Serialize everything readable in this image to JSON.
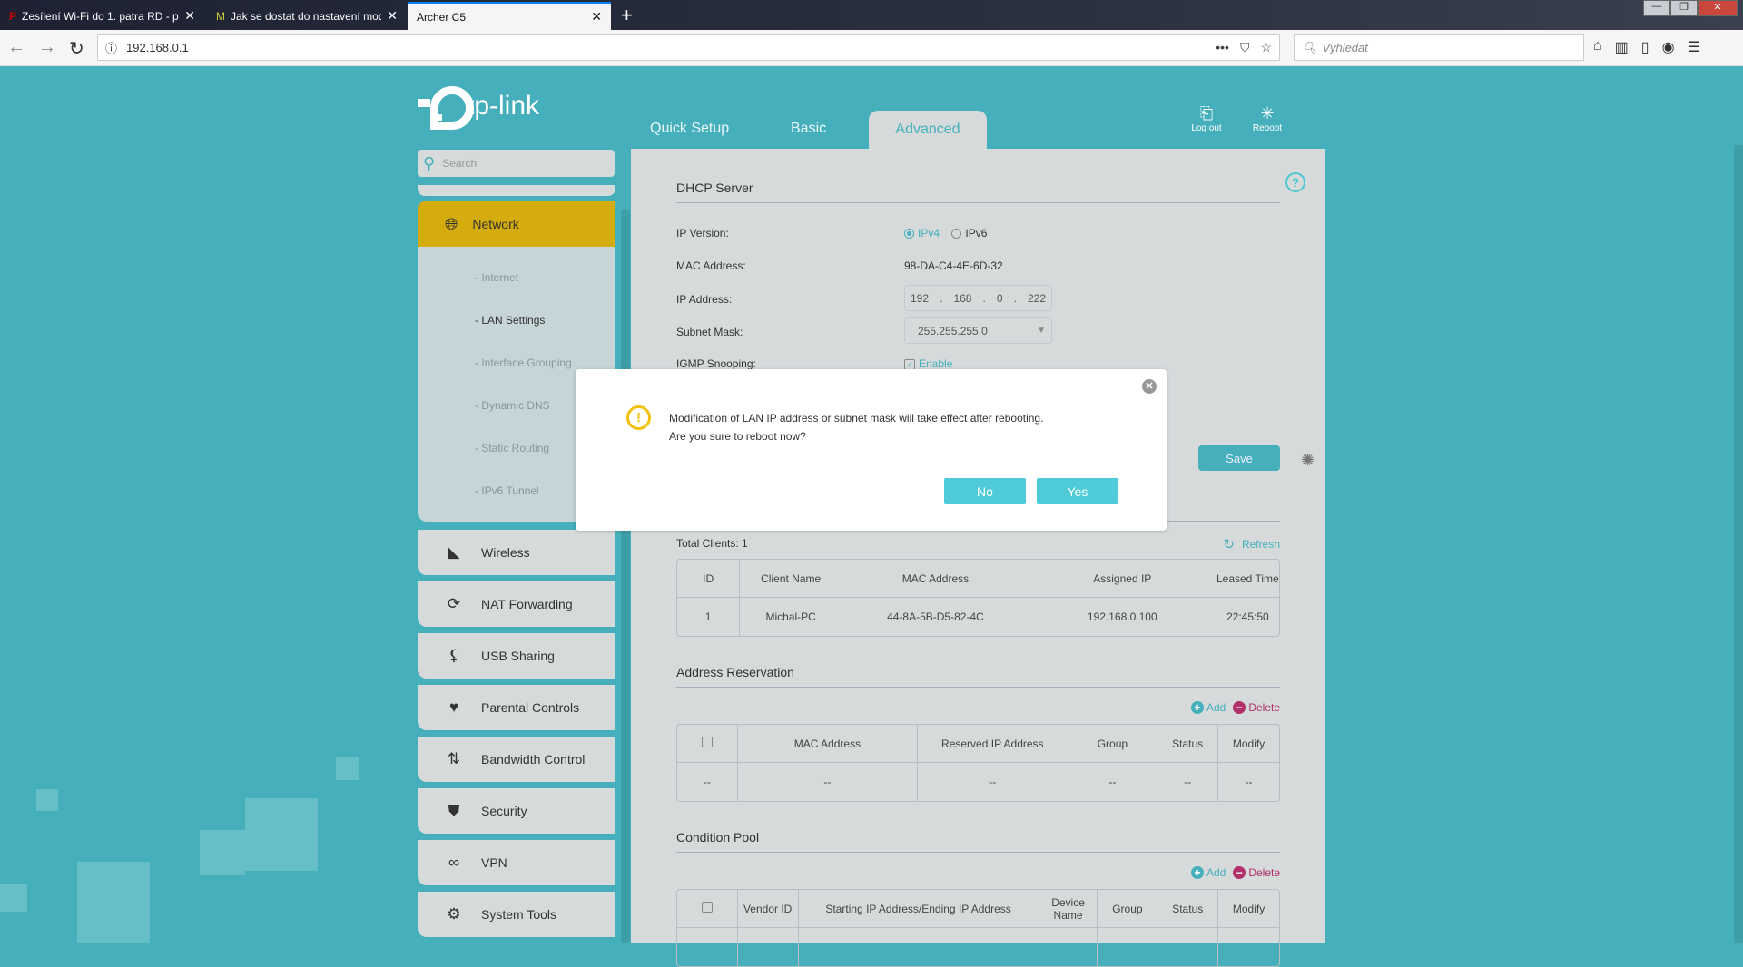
{
  "browser": {
    "tabs": [
      {
        "title": "Zesílení Wi-Fi do 1. patra RD - p"
      },
      {
        "title": "Jak se dostat do nastavení mod"
      },
      {
        "title": "Archer C5"
      }
    ],
    "url": "192.168.0.1",
    "search_placeholder": "Vyhledat"
  },
  "header": {
    "logo": "tp-link",
    "tabs": [
      "Quick Setup",
      "Basic",
      "Advanced"
    ],
    "logout": "Log out",
    "reboot": "Reboot"
  },
  "sidebar": {
    "search_placeholder": "Search",
    "active": "Network",
    "subitems": [
      "- Internet",
      "- LAN Settings",
      "- Interface Grouping",
      "- Dynamic DNS",
      "- Static Routing",
      "- IPv6 Tunnel"
    ],
    "items": [
      {
        "label": "Wireless",
        "icon": "wifi-icon"
      },
      {
        "label": "NAT Forwarding",
        "icon": "nat-icon"
      },
      {
        "label": "USB Sharing",
        "icon": "usb-icon"
      },
      {
        "label": "Parental Controls",
        "icon": "heart-icon"
      },
      {
        "label": "Bandwidth Control",
        "icon": "arrows-icon"
      },
      {
        "label": "Security",
        "icon": "shield-icon"
      },
      {
        "label": "VPN",
        "icon": "link-icon"
      },
      {
        "label": "System Tools",
        "icon": "gear-icon"
      }
    ]
  },
  "dhcp": {
    "title": "DHCP Server",
    "ip_version_label": "IP Version:",
    "ipv4": "IPv4",
    "ipv6": "IPv6",
    "mac_label": "MAC Address:",
    "mac": "98-DA-C4-4E-6D-32",
    "ip_label": "IP Address:",
    "ip": [
      "192",
      "168",
      "0",
      "222"
    ],
    "mask_label": "Subnet Mask:",
    "mask": "255.255.255.0",
    "igmp_label": "IGMP Snooping:",
    "igmp": "Enable",
    "save": "Save"
  },
  "clients": {
    "total": "Total Clients: 1",
    "refresh": "Refresh",
    "headers": [
      "ID",
      "Client Name",
      "MAC Address",
      "Assigned IP",
      "Leased Time"
    ],
    "rows": [
      [
        "1",
        "Michal-PC",
        "44-8A-5B-D5-82-4C",
        "192.168.0.100",
        "22:45:50"
      ]
    ]
  },
  "reservation": {
    "title": "Address Reservation",
    "add": "Add",
    "delete": "Delete",
    "headers": [
      "",
      "MAC Address",
      "Reserved IP Address",
      "Group",
      "Status",
      "Modify"
    ],
    "rows": [
      [
        "--",
        "--",
        "--",
        "--",
        "--",
        "--"
      ]
    ]
  },
  "pool": {
    "title": "Condition Pool",
    "add": "Add",
    "delete": "Delete",
    "headers": [
      "",
      "Vendor ID",
      "Starting IP Address/Ending IP Address",
      "Device Name",
      "Group",
      "Status",
      "Modify"
    ]
  },
  "dialog": {
    "message": "Modification of LAN IP address or subnet mask will take effect after rebooting. Are you sure to reboot now?",
    "no": "No",
    "yes": "Yes"
  },
  "colors": {
    "teal": "#45b0bb",
    "active": "#d4ac0d",
    "delete": "#b0306a",
    "warning": "#f2c00d"
  }
}
